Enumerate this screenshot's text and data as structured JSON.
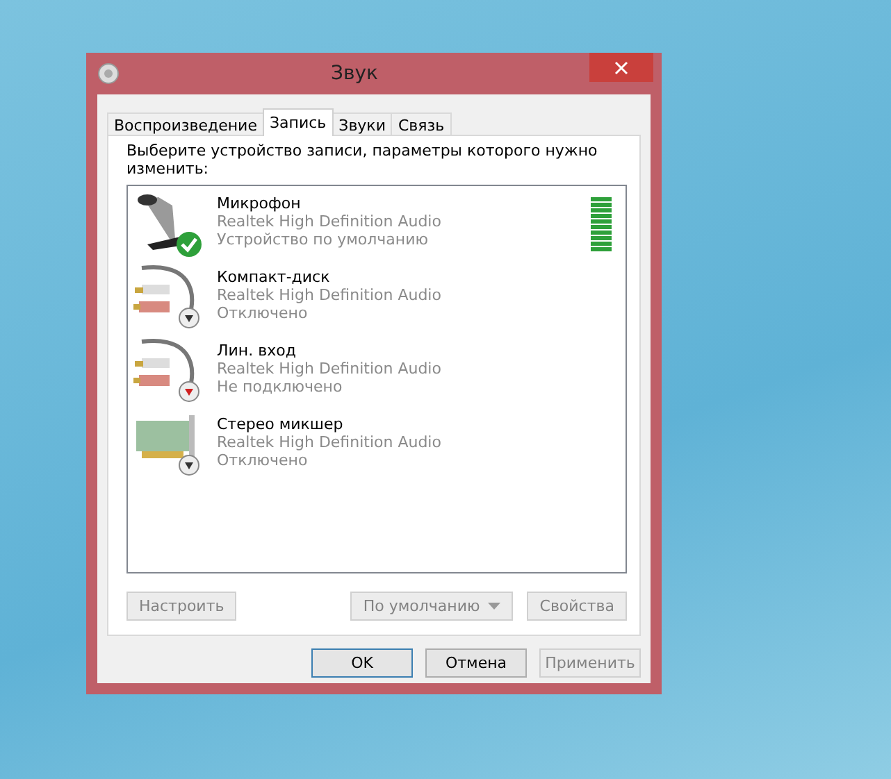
{
  "window": {
    "title": "Звук"
  },
  "tabs": [
    {
      "label": "Воспроизведение",
      "selected": false
    },
    {
      "label": "Запись",
      "selected": true
    },
    {
      "label": "Звуки",
      "selected": false
    },
    {
      "label": "Связь",
      "selected": false
    }
  ],
  "instruction": "Выберите устройство записи, параметры которого нужно изменить:",
  "devices": [
    {
      "kind": "microphone",
      "badge": {
        "kind": "default"
      },
      "name": "Микрофон",
      "driver": "Realtek High Definition Audio",
      "status": "Устройство по умолчанию",
      "level": 1
    },
    {
      "kind": "cable",
      "badge": {
        "kind": "disabled"
      },
      "name": "Компакт-диск",
      "driver": "Realtek High Definition Audio",
      "status": "Отключено"
    },
    {
      "kind": "cable",
      "badge": {
        "kind": "unplugged"
      },
      "name": "Лин. вход",
      "driver": "Realtek High Definition Audio",
      "status": "Не подключено"
    },
    {
      "kind": "card",
      "badge": {
        "kind": "disabled"
      },
      "name": "Стерео микшер",
      "driver": "Realtek High Definition Audio",
      "status": "Отключено"
    }
  ],
  "panel_buttons": [
    {
      "label": "Настроить",
      "disabled": true
    },
    {
      "label": "По умолчанию",
      "disabled": true,
      "split": true
    },
    {
      "label": "Свойства",
      "disabled": true
    }
  ],
  "dialog_buttons": [
    {
      "label": "OK",
      "disabled": false,
      "default": true
    },
    {
      "label": "Отмена",
      "disabled": false,
      "default": false
    },
    {
      "label": "Применить",
      "disabled": true,
      "default": false
    }
  ]
}
